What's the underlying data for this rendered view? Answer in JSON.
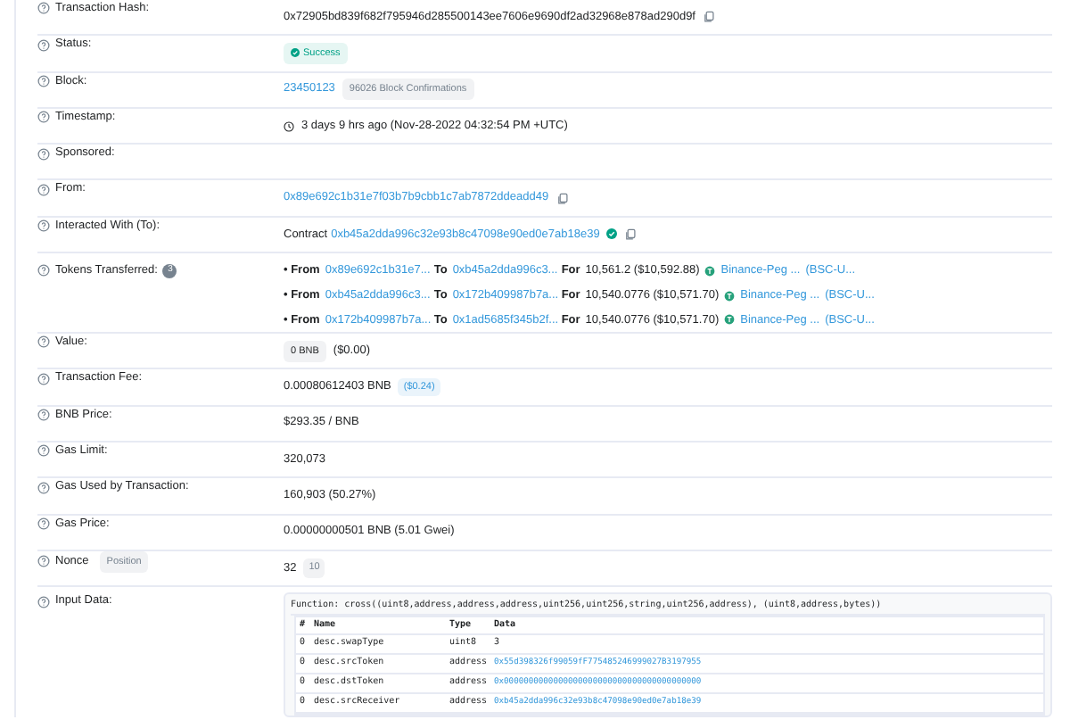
{
  "rows": [
    {
      "kind": "hash",
      "label": "Transaction Hash:",
      "value": "0x72905bd839f682f795946d285500143ee7606e9690df2ad32968e878ad290d9f"
    },
    {
      "kind": "status",
      "label": "Status:",
      "value": "Success"
    },
    {
      "kind": "block",
      "label": "Block:",
      "value": "23450123",
      "badge": "96026 Block Confirmations"
    },
    {
      "kind": "time",
      "label": "Timestamp:",
      "value": "3 days 9 hrs ago (Nov-28-2022 04:32:54 PM +UTC)"
    },
    {
      "kind": "empty",
      "label": "Sponsored:"
    },
    {
      "kind": "from",
      "label": "From:",
      "value": "0x89e692c1b31e7f03b7b9cbb1c7ab7872ddeadd49"
    },
    {
      "kind": "contract",
      "label": "Interacted With (To):",
      "prefix": "Contract",
      "value": "0xb45a2dda996c32e93b8c47098e90ed0e7ab18e39"
    },
    {
      "kind": "tokens",
      "label": "Tokens Transferred:",
      "count": "3",
      "transfers": [
        {
          "from_label": "• From",
          "to_label": "To",
          "for_label": "For",
          "from": "0x89e692c1b31e7...",
          "to": "0xb45a2dda996c3...",
          "amount": "10,561.2 ($10,592.88)",
          "token": "Binance-Peg ...",
          "symbol": "(BSC-U..."
        },
        {
          "from_label": "• From",
          "to_label": "To",
          "for_label": "For",
          "from": "0xb45a2dda996c3...",
          "to": "0x172b409987b7a...",
          "amount": "10,540.0776 ($10,571.70)",
          "token": "Binance-Peg ...",
          "symbol": "(BSC-U..."
        },
        {
          "from_label": "• From",
          "to_label": "To",
          "for_label": "For",
          "from": "0x172b409987b7a...",
          "to": "0x1ad5685f345b2f...",
          "amount": "10,540.0776 ($10,571.70)",
          "token": "Binance-Peg ...",
          "symbol": "(BSC-U..."
        }
      ]
    },
    {
      "kind": "value",
      "label": "Value:",
      "value": "0 BNB",
      "usd": "($0.00)"
    },
    {
      "kind": "fee",
      "label": "Transaction Fee:",
      "value": "0.00080612403 BNB",
      "usd": "($0.24)"
    },
    {
      "kind": "text",
      "label": "BNB Price:",
      "value": "$293.35 / BNB"
    },
    {
      "kind": "text",
      "label": "Gas Limit:",
      "value": "320,073"
    },
    {
      "kind": "text",
      "label": "Gas Used by Transaction:",
      "value": "160,903 (50.27%)"
    },
    {
      "kind": "text",
      "label": "Gas Price:",
      "value": "0.00000000501 BNB (5.01 Gwei)"
    },
    {
      "kind": "nonce",
      "label": "Nonce",
      "label_badge": "Position",
      "value": "32",
      "badge": "10"
    }
  ],
  "input_data": {
    "label": "Input Data:",
    "function": "Function: cross((uint8,address,address,address,uint256,uint256,string,uint256,address), (uint8,address,bytes))",
    "columns": [
      "#",
      "Name",
      "Type",
      "Data"
    ],
    "rows": [
      {
        "index": "0",
        "name": "desc.swapType",
        "type": "uint8",
        "data": "3",
        "kind": "value"
      },
      {
        "index": "0",
        "name": "desc.srcToken",
        "type": "address",
        "data": "0x55d398326f99059fF775485246999027B3197955",
        "kind": "address"
      },
      {
        "index": "0",
        "name": "desc.dstToken",
        "type": "address",
        "data": "0x0000000000000000000000000000000000000000",
        "kind": "address"
      },
      {
        "index": "0",
        "name": "desc.srcReceiver",
        "type": "address",
        "data": "0xb45a2dda996c32e93b8c47098e90ed0e7ab18e39",
        "kind": "address"
      }
    ]
  }
}
